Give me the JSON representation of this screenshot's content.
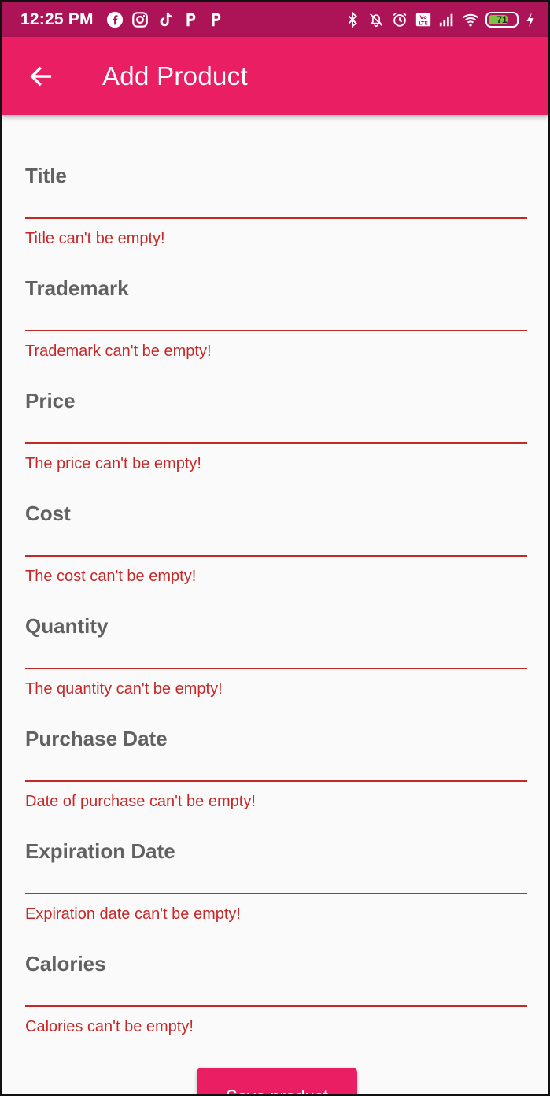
{
  "status_bar": {
    "time": "12:25 PM",
    "battery_level": "71",
    "notification_icons": [
      "facebook-icon",
      "instagram-icon",
      "tiktok-icon",
      "p-app-icon",
      "p-app-icon"
    ],
    "system_icons": [
      "bluetooth-icon",
      "mute-icon",
      "alarm-icon",
      "volte-icon",
      "signal-icon",
      "wifi-icon",
      "battery-icon",
      "charging-icon"
    ]
  },
  "app_bar": {
    "title": "Add Product",
    "back_icon": "arrow-back-icon",
    "background_color": "#e91e63"
  },
  "form": {
    "fields": [
      {
        "label": "Title",
        "error": "Title can't be empty!"
      },
      {
        "label": "Trademark",
        "error": "Trademark can't be empty!"
      },
      {
        "label": "Price",
        "error": "The price can't be empty!"
      },
      {
        "label": "Cost",
        "error": "The cost can't be empty!"
      },
      {
        "label": "Quantity",
        "error": "The quantity can't be empty!"
      },
      {
        "label": "Purchase Date",
        "error": "Date of purchase can't be empty!"
      },
      {
        "label": "Expiration Date",
        "error": "Expiration date can't be empty!"
      },
      {
        "label": "Calories",
        "error": "Calories can't be empty!"
      }
    ],
    "error_color": "#c62828"
  },
  "save_button": {
    "label": "Save product"
  },
  "colors": {
    "primary": "#e91e63",
    "status_bar": "#ad1457",
    "label": "#616161",
    "background": "#fafafa"
  }
}
